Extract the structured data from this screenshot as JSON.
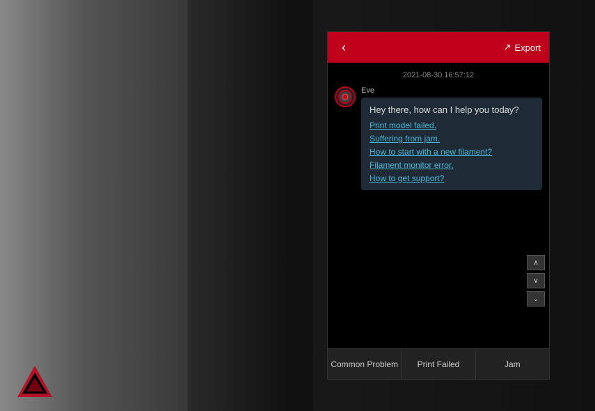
{
  "background": {
    "description": "3D printer background"
  },
  "header": {
    "back_label": "‹",
    "export_label": "Export",
    "export_icon": "export-icon"
  },
  "chat": {
    "timestamp": "2021-08-30 16:57:12",
    "sender_name": "Eve",
    "greeting": "Hey there, how can I help you today?",
    "options": [
      {
        "id": 1,
        "text": "Print model failed."
      },
      {
        "id": 2,
        "text": "Suffering from jam."
      },
      {
        "id": 3,
        "text": "How to start with a new filament?"
      },
      {
        "id": 4,
        "text": "Filament monitor error."
      },
      {
        "id": 5,
        "text": "How to get support?"
      }
    ]
  },
  "scroll_buttons": {
    "up_icon": "chevron-up-icon",
    "down_icon": "chevron-down-icon",
    "bottom_icon": "chevron-double-down-icon"
  },
  "tabs": [
    {
      "id": "common-problem",
      "label": "Common Problem"
    },
    {
      "id": "print-failed",
      "label": "Print Failed"
    },
    {
      "id": "jam",
      "label": "Jam"
    }
  ]
}
